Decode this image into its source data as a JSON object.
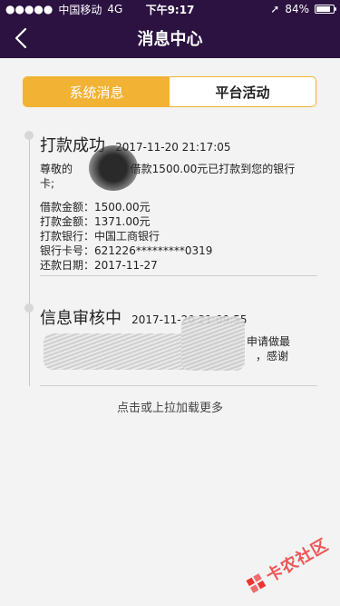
{
  "status_bar": {
    "carrier": "中国移动",
    "network": "4G",
    "time": "下午9:17",
    "battery_percent_text": "84%",
    "battery_level": 0.84
  },
  "nav": {
    "title": "消息中心"
  },
  "tabs": [
    {
      "label": "系统消息",
      "active": true
    },
    {
      "label": "平台活动",
      "active": false
    }
  ],
  "messages": [
    {
      "title": "打款成功",
      "time": "2017-11-20 21:17:05",
      "body_prefix": "尊敬的",
      "body_suffix": "借款1500.00元已打款到您的银行卡;",
      "details": [
        {
          "label": "借款金额：",
          "value": "1500.00元"
        },
        {
          "label": "打款金额：",
          "value": "1371.00元"
        },
        {
          "label": "打款银行：",
          "value": "中国工商银行"
        },
        {
          "label": "银行卡号：",
          "value": "621226*********0319"
        },
        {
          "label": "还款日期：",
          "value": "2017-11-27"
        }
      ]
    },
    {
      "title": "信息审核中",
      "time": "2017-11-20 21:09:55",
      "body_visible_right_1": "申请做最",
      "body_visible_right_2": "，感谢"
    }
  ],
  "load_more": "点击或上拉加载更多",
  "watermark": "卡农社区"
}
